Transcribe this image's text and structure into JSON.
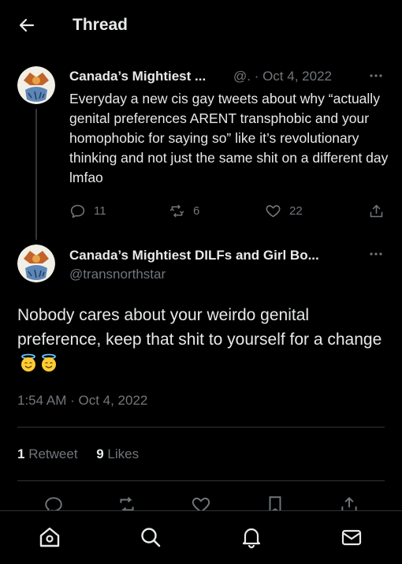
{
  "header": {
    "title": "Thread",
    "back_icon": "arrow-left-icon"
  },
  "tweet1": {
    "name": "Canada’s Mightiest ...",
    "meta": "@. · Oct 4, 2022",
    "text": "Everyday a new cis gay tweets about why “actually genital preferences ARENT transphobic and your homophobic for saying so” like it’s revolutionary thinking and not just the same shit on a different day lmfao",
    "replies": "11",
    "retweets": "6",
    "likes": "22"
  },
  "tweet2": {
    "name": "Canada’s Mightiest DILFs and Girl Bo...",
    "handle": "@transnorthstar",
    "text": "Nobody cares about your weirdo genital preference, keep that shit to yourself for a change",
    "emoji": "smiling-face-with-halo",
    "time": "1:54 AM · Oct 4, 2022",
    "retweets_count": "1",
    "retweets_label": "Retweet",
    "likes_count": "9",
    "likes_label": "Likes"
  },
  "bottom_nav": [
    "home-icon",
    "search-icon",
    "notifications-icon",
    "messages-icon"
  ],
  "colors": {
    "background": "#000000",
    "text": "#e7e9ea",
    "muted": "#71767b",
    "divider": "#2f3336"
  }
}
